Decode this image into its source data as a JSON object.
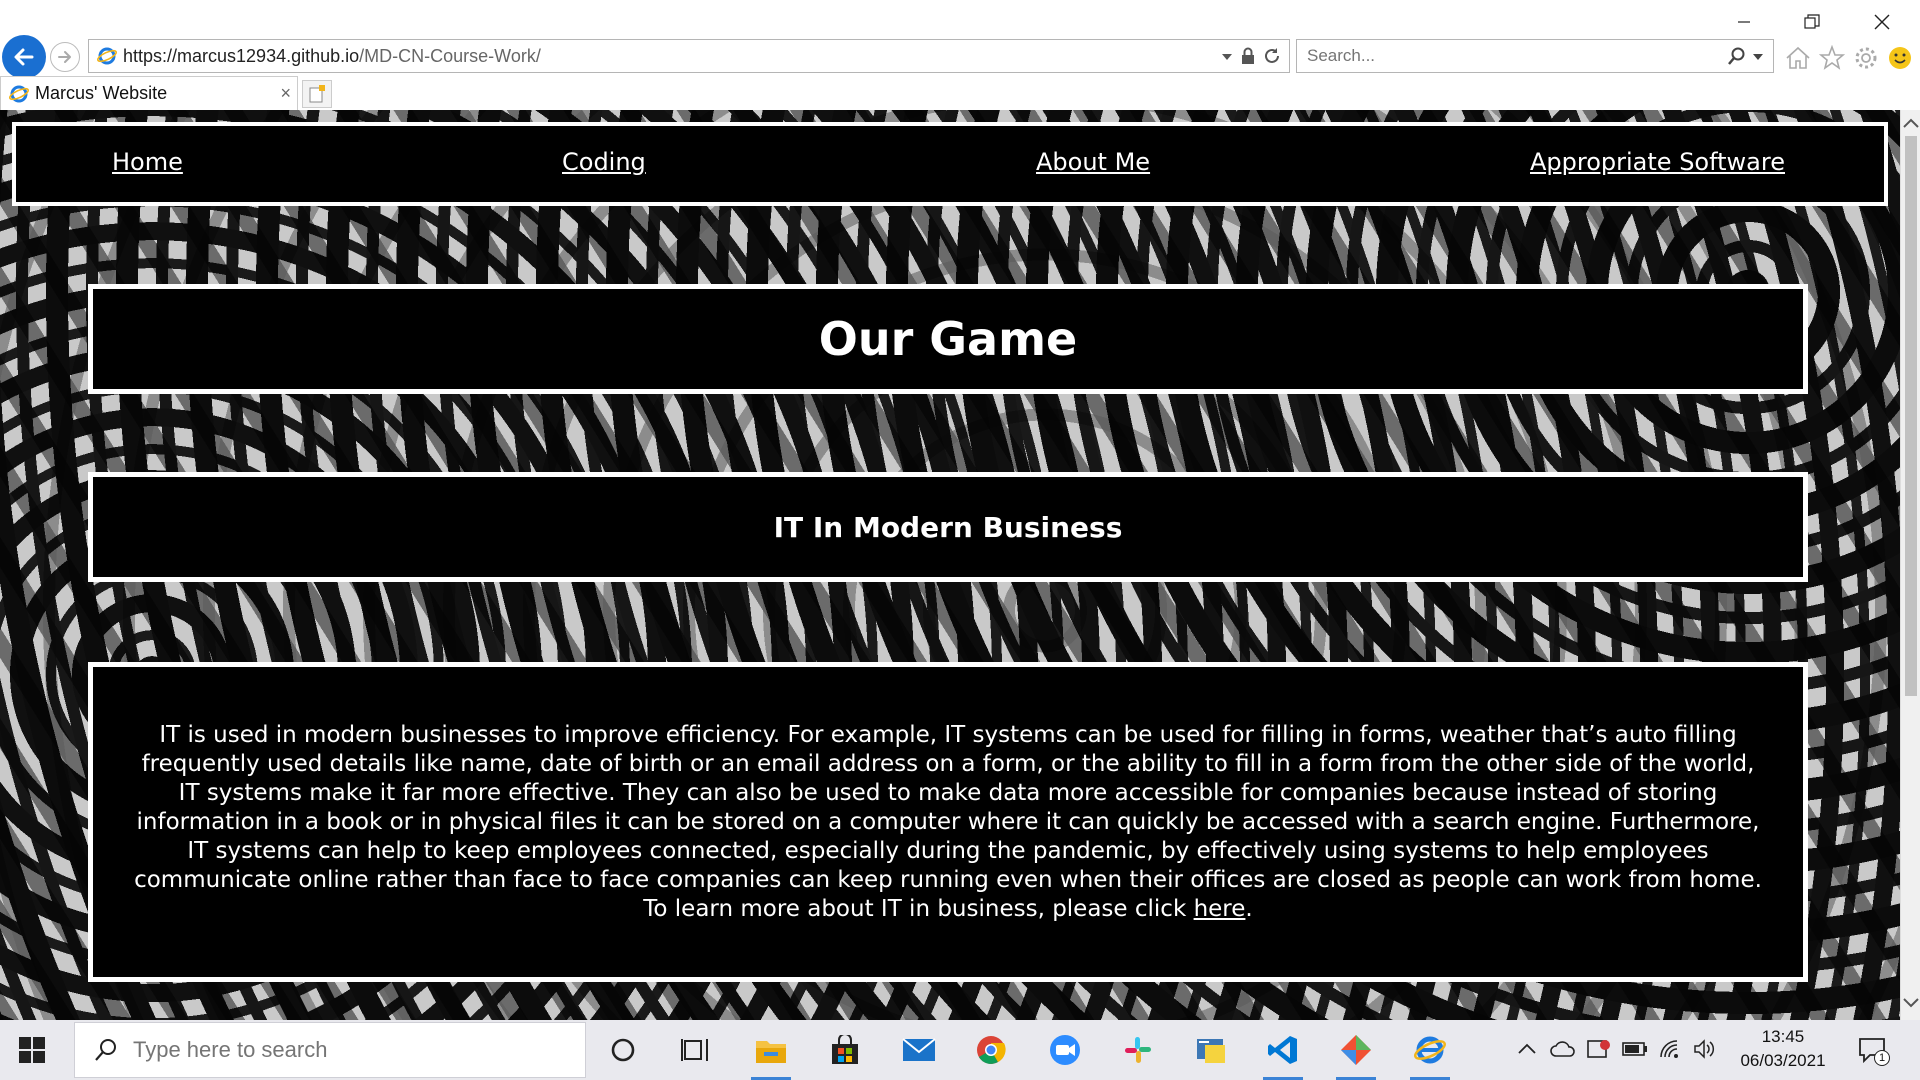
{
  "browser": {
    "url_host": "https://marcus12934.github.io",
    "url_path": "/MD-CN-Course-Work/",
    "search_placeholder": "Search...",
    "tab_title": "Marcus' Website",
    "tab_close": "×"
  },
  "nav": {
    "items": [
      "Home",
      "Coding",
      "About Me",
      "Appropriate Software"
    ]
  },
  "page": {
    "title": "Our Game",
    "subtitle": "IT In Modern Business",
    "body_text": "IT is used in modern businesses to improve efficiency. For example, IT systems can be used for filling in forms, weather that’s auto filling frequently used details like name, date of birth or an email address on a form, or the ability to fill in a form from the other side of the world, IT systems make it far more effective. They can also be used to make data more accessible for companies because instead of storing information in a book or in physical files it can be stored on a computer where it can quickly be accessed with a search engine. Furthermore, IT systems can help to keep employees connected, especially during the pandemic, by effectively using systems to help employees communicate online rather than face to face companies can keep running even when their offices are closed as people can work from home. To learn more about IT in business, please click",
    "link_text": "here",
    "body_end": "."
  },
  "taskbar": {
    "search_placeholder": "Type here to search",
    "time": "13:45",
    "date": "06/03/2021",
    "notification_count": "1",
    "apps": [
      "task-view-icon",
      "file-explorer-icon",
      "store-icon",
      "mail-icon",
      "chrome-icon",
      "zoom-icon",
      "slack-icon",
      "python-icon",
      "vscode-icon",
      "git-icon",
      "internet-explorer-icon"
    ]
  },
  "colors": {
    "accent_blue": "#1a6fd1",
    "page_box_bg": "#000000",
    "page_box_border": "#ffffff",
    "taskbar_bg": "#e9e9ee"
  }
}
